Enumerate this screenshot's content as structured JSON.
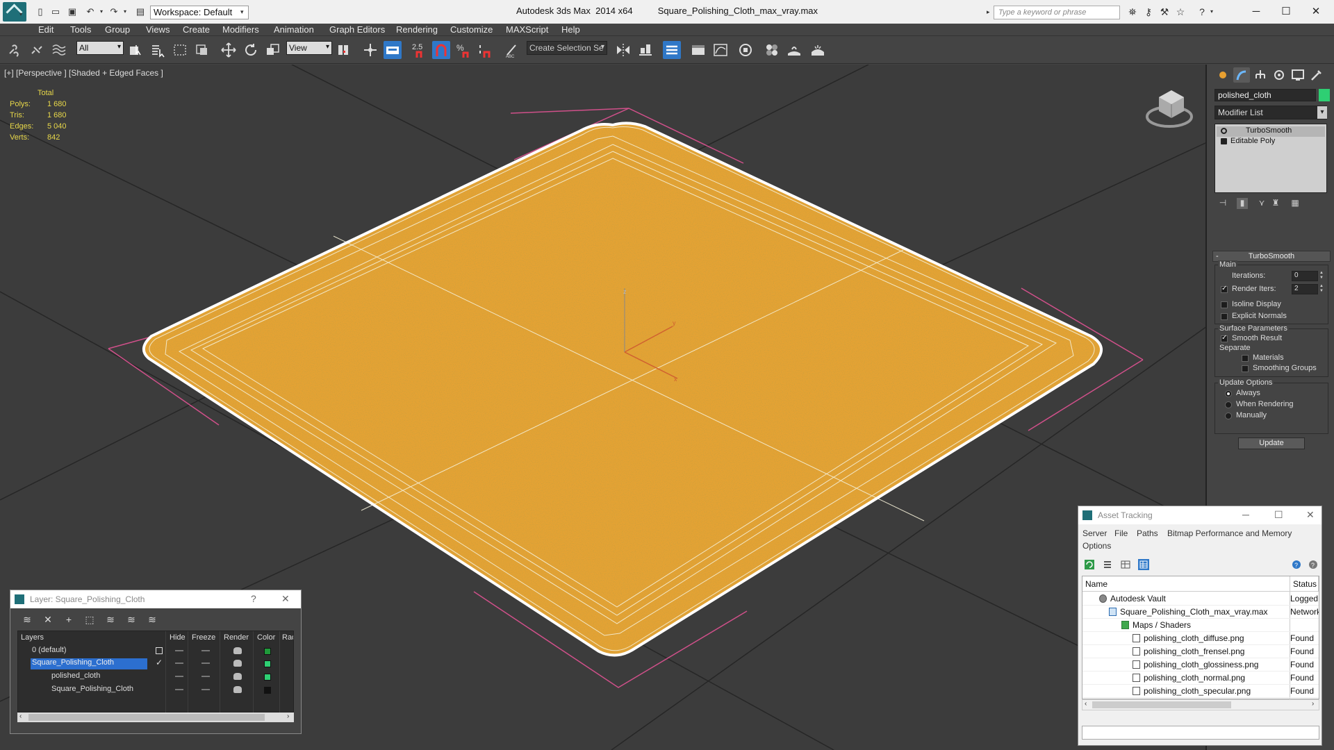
{
  "titlebar": {
    "workspace_label": "Workspace: Default",
    "app_title": "Autodesk 3ds Max  2014 x64",
    "file_name": "Square_Polishing_Cloth_max_vray.max",
    "search_placeholder": "Type a keyword or phrase"
  },
  "menu": [
    "Edit",
    "Tools",
    "Group",
    "Views",
    "Create",
    "Modifiers",
    "Animation",
    "Graph Editors",
    "Rendering",
    "Customize",
    "MAXScript",
    "Help"
  ],
  "toolbar": {
    "selection_filter": "All",
    "reference_coord": "View",
    "snap_angle_label": "2.5",
    "named_selection_placeholder": "Create Selection Se"
  },
  "viewport": {
    "label": "[+] [Perspective ] [Shaded + Edged Faces ]",
    "stats": {
      "header": "Total",
      "rows": [
        {
          "label": "Polys:",
          "value": "1 680"
        },
        {
          "label": "Tris:",
          "value": "1 680"
        },
        {
          "label": "Edges:",
          "value": "5 040"
        },
        {
          "label": "Verts:",
          "value": "842"
        }
      ]
    },
    "axis_labels": {
      "z": "z",
      "y": "y",
      "x": "x"
    },
    "colors": {
      "cloth": "#e6a233",
      "wire": "#f5f0d8",
      "bbox": "#d0508a",
      "grid": "#2a2a2a",
      "bg": "#3c3c3c"
    }
  },
  "command_panel": {
    "object_name": "polished_cloth",
    "object_color": "#2ecf73",
    "modifier_list_label": "Modifier List",
    "stack": [
      "TurboSmooth",
      "Editable Poly"
    ],
    "rollout_title": "TurboSmooth",
    "main_group": "Main",
    "iterations_label": "Iterations:",
    "iterations_value": "0",
    "render_iters_label": "Render Iters:",
    "render_iters_value": "2",
    "render_iters_checked": true,
    "isoline_label": "Isoline Display",
    "explicit_normals_label": "Explicit Normals",
    "surface_group": "Surface Parameters",
    "smooth_result_label": "Smooth Result",
    "separate_label": "Separate",
    "materials_label": "Materials",
    "smoothing_groups_label": "Smoothing Groups",
    "update_group": "Update Options",
    "update_options": [
      "Always",
      "When Rendering",
      "Manually"
    ],
    "update_selected": "Always",
    "update_button": "Update"
  },
  "layer_window": {
    "title": "Layer: Square_Polishing_Cloth",
    "help": "?",
    "columns": [
      "Layers",
      "Hide",
      "Freeze",
      "Render",
      "Color",
      "Rad"
    ],
    "rows": [
      {
        "name": "0 (default)",
        "color": "#1f9a3a",
        "selected": false
      },
      {
        "name": "Square_Polishing_Cloth",
        "color": "#2ecf73",
        "selected": true
      },
      {
        "name": "polished_cloth",
        "color": "#2ecf73",
        "selected": false
      },
      {
        "name": "Square_Polishing_Cloth",
        "color": "#111111",
        "selected": false
      }
    ]
  },
  "asset_window": {
    "title": "Asset Tracking",
    "menu": [
      "Server",
      "File",
      "Paths",
      "Bitmap Performance and Memory",
      "Options"
    ],
    "columns": [
      "Name",
      "Status"
    ],
    "rows": [
      {
        "name": "Autodesk Vault",
        "status": "Logged O",
        "icon": "vault-icon"
      },
      {
        "name": "Square_Polishing_Cloth_max_vray.max",
        "status": "Network",
        "icon": "max-file-icon"
      },
      {
        "name": "Maps / Shaders",
        "status": "",
        "icon": "folder-icon"
      },
      {
        "name": "polishing_cloth_diffuse.png",
        "status": "Found",
        "icon": "image-file-icon"
      },
      {
        "name": "polishing_cloth_frensel.png",
        "status": "Found",
        "icon": "image-file-icon"
      },
      {
        "name": "polishing_cloth_glossiness.png",
        "status": "Found",
        "icon": "image-file-icon"
      },
      {
        "name": "polishing_cloth_normal.png",
        "status": "Found",
        "icon": "image-file-icon"
      },
      {
        "name": "polishing_cloth_specular.png",
        "status": "Found",
        "icon": "image-file-icon"
      }
    ]
  }
}
